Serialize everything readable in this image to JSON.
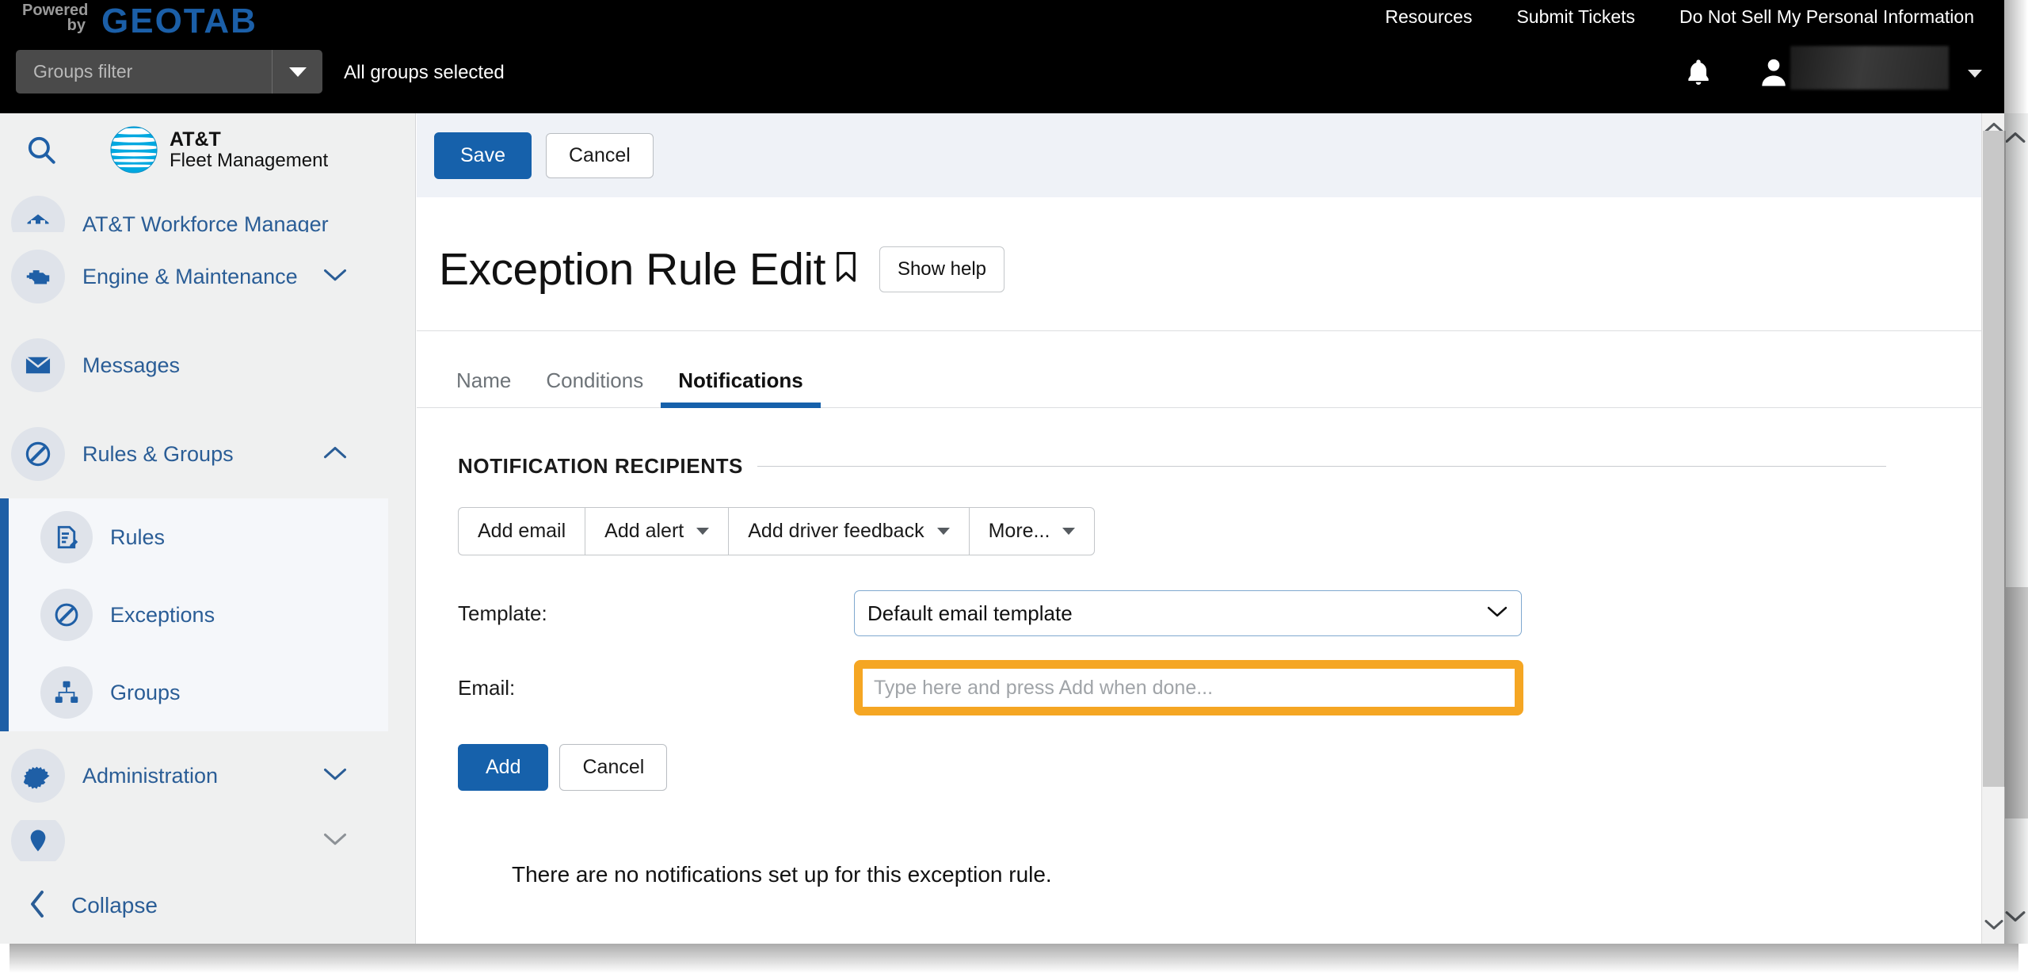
{
  "topbar": {
    "powered_line1": "Powered",
    "powered_line2": "by",
    "brand": "GEOTAB",
    "nav": [
      {
        "label": "Resources"
      },
      {
        "label": "Submit Tickets"
      },
      {
        "label": "Do Not Sell My Personal Information"
      }
    ],
    "groups_filter_placeholder": "Groups filter",
    "all_groups_selected": "All groups selected",
    "bell_icon": "notification-bell-icon",
    "account_icon": "user-account-icon",
    "account_name": ""
  },
  "sidebar": {
    "search_icon": "search-icon",
    "product_line1": "AT&T",
    "product_line2": "Fleet Management",
    "items": [
      {
        "label": "AT&T Workforce Manager",
        "icon": "workforce-icon",
        "state": "partial"
      },
      {
        "label": "Engine & Maintenance",
        "icon": "engine-icon",
        "chevron": "down"
      },
      {
        "label": "Messages",
        "icon": "envelope-icon"
      },
      {
        "label": "Rules & Groups",
        "icon": "rules-circle-icon",
        "chevron": "up",
        "expanded": true
      }
    ],
    "sub_items": [
      {
        "label": "Rules",
        "icon": "rules-document-icon"
      },
      {
        "label": "Exceptions",
        "icon": "exception-circle-icon"
      },
      {
        "label": "Groups",
        "icon": "groups-hierarchy-icon"
      }
    ],
    "items_after": [
      {
        "label": "Administration",
        "icon": "gear-icon",
        "chevron": "down"
      },
      {
        "label": "",
        "icon": "map-pin-icon",
        "state": "cutoff",
        "chevron": "down"
      }
    ],
    "collapse_label": "Collapse"
  },
  "main": {
    "actions": {
      "save_label": "Save",
      "cancel_label": "Cancel"
    },
    "page_title": "Exception Rule Edit",
    "bookmark_icon": "bookmark-icon",
    "show_help_label": "Show help",
    "tabs": [
      {
        "label": "Name",
        "active": false
      },
      {
        "label": "Conditions",
        "active": false
      },
      {
        "label": "Notifications",
        "active": true
      }
    ],
    "section_title": "NOTIFICATION RECIPIENTS",
    "recipient_buttons": [
      {
        "label": "Add email",
        "has_caret": false
      },
      {
        "label": "Add alert",
        "has_caret": true
      },
      {
        "label": "Add driver feedback",
        "has_caret": true
      },
      {
        "label": "More...",
        "has_caret": true
      }
    ],
    "template_label": "Template:",
    "template_value": "Default email template",
    "template_options": [
      "Default email template"
    ],
    "email_label": "Email:",
    "email_value": "",
    "email_placeholder": "Type here and press Add when done...",
    "add_label": "Add",
    "form_cancel_label": "Cancel",
    "empty_message": "There are no notifications set up for this exception rule."
  },
  "colors": {
    "accent_blue": "#1661ab",
    "sidebar_link": "#2a5d96",
    "highlight_orange": "#f5a623",
    "topbar_bg": "#000000"
  }
}
